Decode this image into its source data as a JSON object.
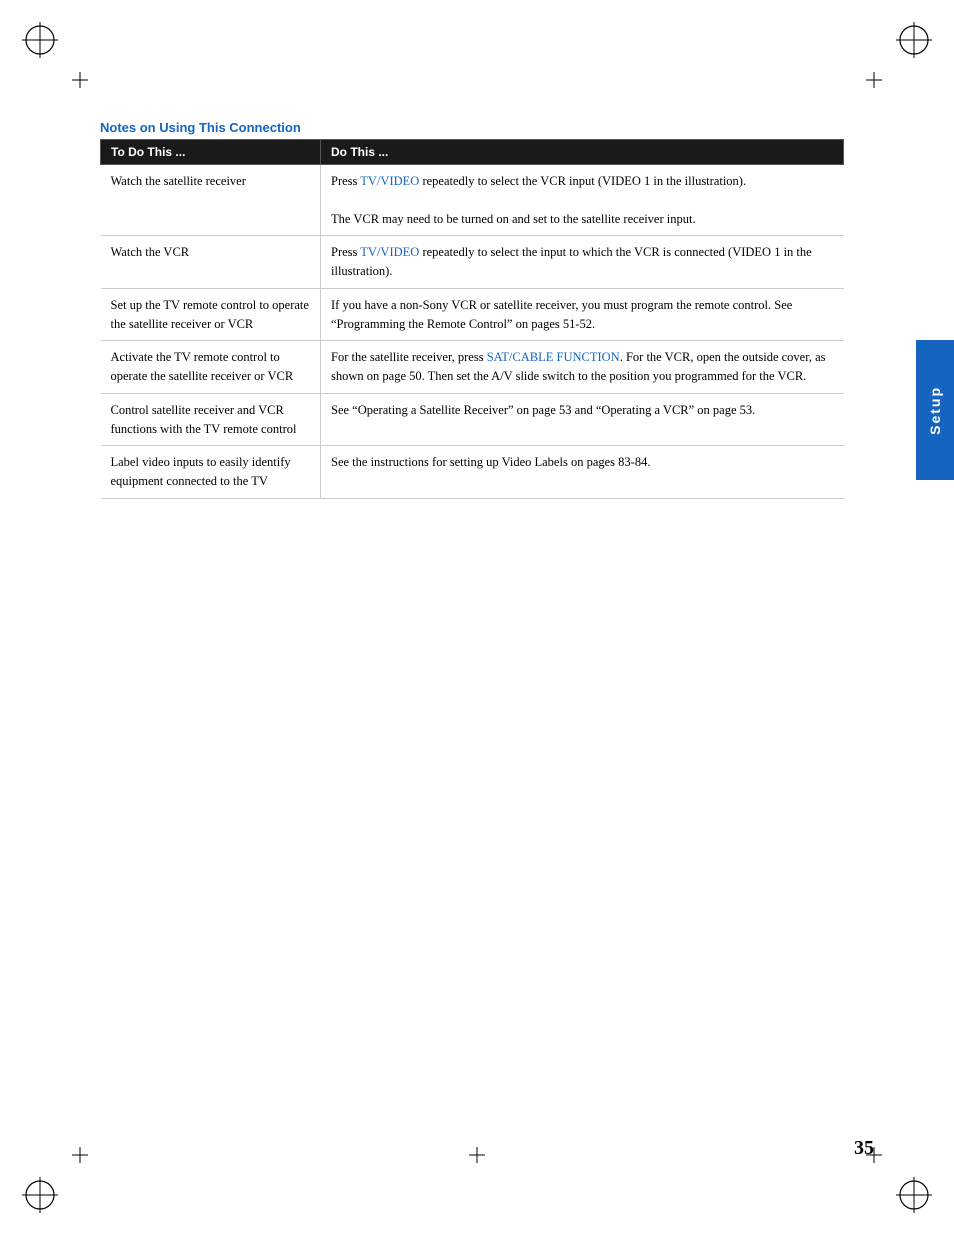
{
  "page": {
    "number": "35",
    "background": "#ffffff"
  },
  "side_tab": {
    "label": "Setup"
  },
  "section": {
    "title": "Notes on Using This Connection",
    "table": {
      "headers": [
        "To Do This ...",
        "Do This ..."
      ],
      "rows": [
        {
          "action": "Watch the satellite receiver",
          "instructions": [
            "Press TV/VIDEO repeatedly to select the VCR input (VIDEO 1 in the illustration).",
            "The VCR may need to be turned on and set to the satellite receiver input."
          ],
          "links_in_instructions": [
            "TV/VIDEO"
          ]
        },
        {
          "action": "Watch the VCR",
          "instructions": [
            "Press TV/VIDEO repeatedly to select the input to which the VCR is connected (VIDEO 1 in the illustration)."
          ],
          "links_in_instructions": [
            "TV/VIDEO"
          ]
        },
        {
          "action": "Set up the TV remote control to operate the satellite receiver or VCR",
          "instructions": [
            "If you have a non-Sony VCR or satellite receiver, you must program the remote control. See “Programming the Remote Control” on pages 51-52."
          ]
        },
        {
          "action": "Activate the TV remote control to operate the satellite receiver or VCR",
          "instructions": [
            "For the satellite receiver, press SAT/CABLE FUNCTION. For the VCR, open the outside cover, as shown on page 50. Then set the A/V slide switch to the position you programmed for the VCR."
          ],
          "links_in_instructions": [
            "SAT/CABLE FUNCTION"
          ]
        },
        {
          "action": "Control satellite receiver and VCR functions with the TV remote control",
          "instructions": [
            "See “Operating a Satellite Receiver” on page 53 and “Operating a VCR” on page 53."
          ]
        },
        {
          "action": "Label video inputs to easily identify equipment connected to the TV",
          "instructions": [
            "See the instructions for setting up Video Labels on pages 83-84."
          ]
        }
      ]
    }
  }
}
